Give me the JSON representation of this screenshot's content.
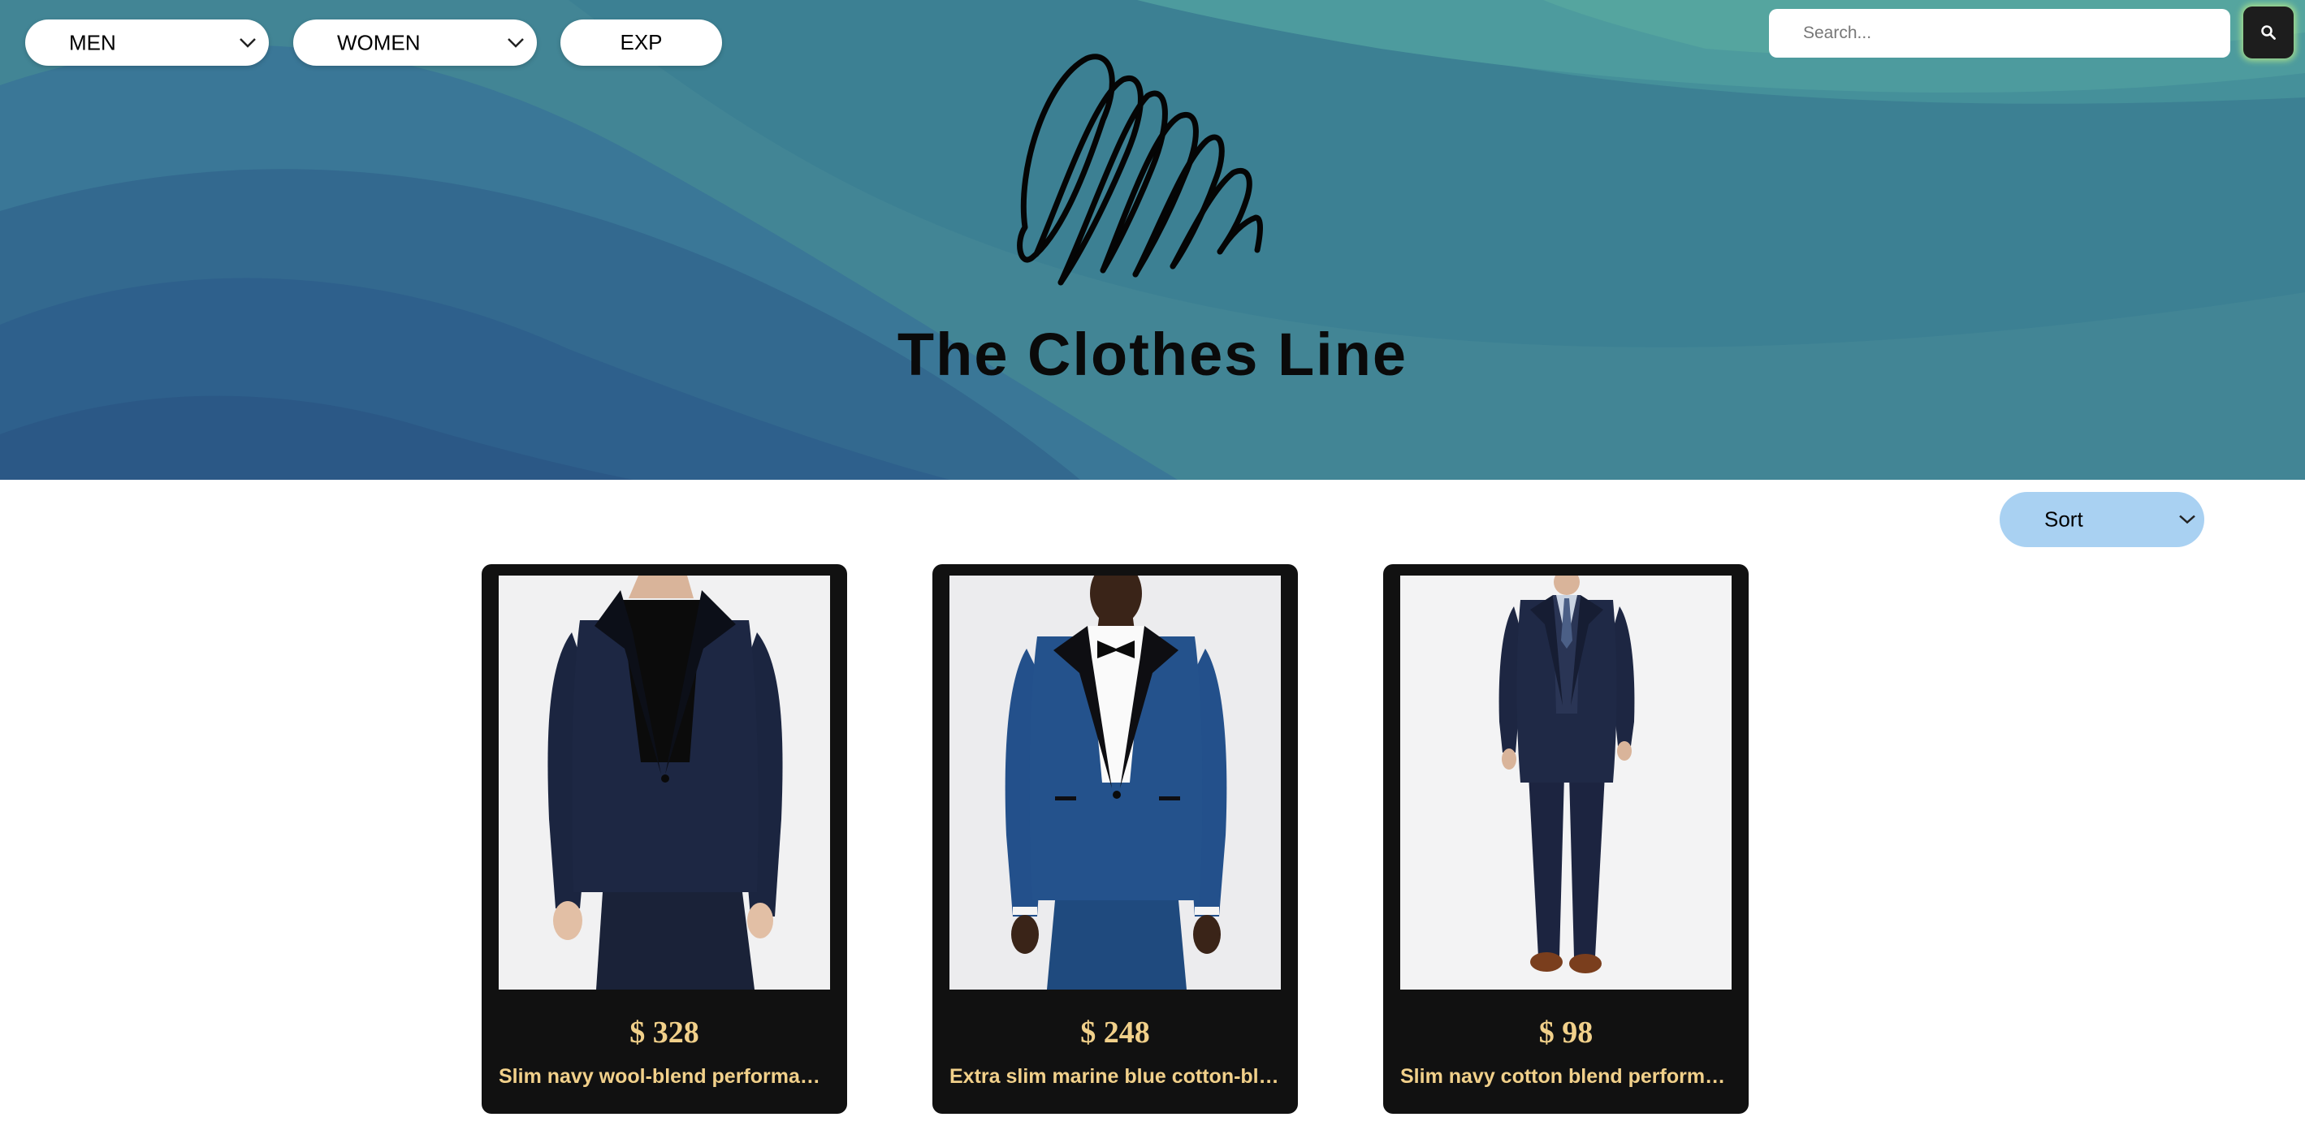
{
  "nav": {
    "men_label": "MEN",
    "women_label": "WOMEN",
    "exp_label": "EXP"
  },
  "search": {
    "placeholder": "Search...",
    "value": "",
    "button_icon": "search-icon"
  },
  "brand": {
    "title": "The Clothes Line",
    "logo": "scribble-logo"
  },
  "sort": {
    "label": "Sort"
  },
  "products": [
    {
      "price": "$ 328",
      "name": "Slim navy wool-blend performance tuxedo jacket"
    },
    {
      "price": "$ 248",
      "name": "Extra slim marine blue cotton-blend tuxedo jacket"
    },
    {
      "price": "$ 98",
      "name": "Slim navy cotton blend performance suit"
    }
  ],
  "colors": {
    "hero_dark": "#2c5f8b",
    "hero_light": "#55a59f",
    "card_bg": "#111111",
    "card_text": "#f1d08a",
    "sort_bg": "#a9d1f2",
    "search_glow": "#d2ff82"
  }
}
